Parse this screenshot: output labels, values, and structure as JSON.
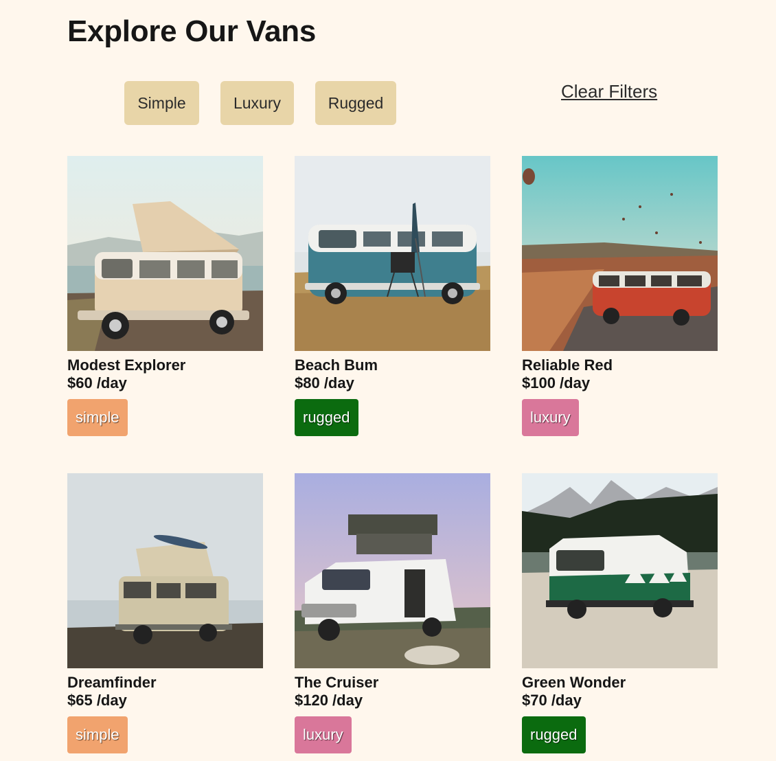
{
  "title": "Explore Our Vans",
  "filters": {
    "simple": "Simple",
    "luxury": "Luxury",
    "rugged": "Rugged",
    "clear": "Clear Filters"
  },
  "badge_colors": {
    "simple": "#e17654",
    "luxury": "#161616",
    "rugged": "#115e59"
  },
  "vans": [
    {
      "name": "Modest Explorer",
      "price": "$60 /day",
      "type": "simple",
      "badge_color": "#f1a36e"
    },
    {
      "name": "Beach Bum",
      "price": "$80 /day",
      "type": "rugged",
      "badge_color": "#0b6b0f"
    },
    {
      "name": "Reliable Red",
      "price": "$100 /day",
      "type": "luxury",
      "badge_color": "#d9779a"
    },
    {
      "name": "Dreamfinder",
      "price": "$65 /day",
      "type": "simple",
      "badge_color": "#f1a36e"
    },
    {
      "name": "The Cruiser",
      "price": "$120 /day",
      "type": "luxury",
      "badge_color": "#d9779a"
    },
    {
      "name": "Green Wonder",
      "price": "$70 /day",
      "type": "rugged",
      "badge_color": "#0b6b0f"
    }
  ]
}
